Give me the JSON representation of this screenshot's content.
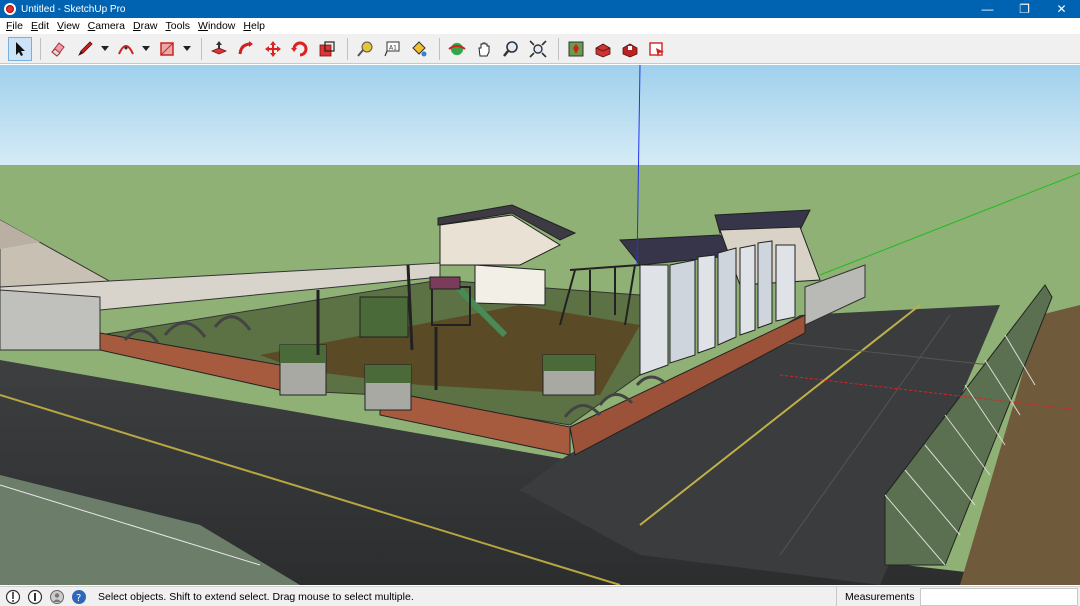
{
  "window": {
    "title": "Untitled - SketchUp Pro",
    "minimize_glyph": "—",
    "restore_glyph": "❐",
    "close_glyph": "✕"
  },
  "menu": [
    {
      "label": "File",
      "key": "F",
      "rest": "ile"
    },
    {
      "label": "Edit",
      "key": "E",
      "rest": "dit"
    },
    {
      "label": "View",
      "key": "V",
      "rest": "iew"
    },
    {
      "label": "Camera",
      "key": "C",
      "rest": "amera"
    },
    {
      "label": "Draw",
      "key": "D",
      "rest": "raw"
    },
    {
      "label": "Tools",
      "key": "T",
      "rest": "ools"
    },
    {
      "label": "Window",
      "key": "W",
      "rest": "indow"
    },
    {
      "label": "Help",
      "key": "H",
      "rest": "elp"
    }
  ],
  "toolbar": {
    "tools": [
      "select-icon",
      "eraser-icon",
      "pencil-line-icon",
      "arc-icon",
      "rectangle-icon",
      "push-pull-icon",
      "follow-me-icon",
      "move-icon",
      "rotate-icon",
      "scale-icon",
      "tape-measure-icon",
      "text-icon",
      "paint-bucket-icon",
      "orbit-icon",
      "pan-icon",
      "zoom-icon",
      "zoom-extents-icon",
      "add-location-icon",
      "3d-warehouse-icon",
      "extension-warehouse-icon",
      "layout-send-icon"
    ],
    "active_tool": "select-icon"
  },
  "viewport": {
    "sky_color": "#bfe0f3",
    "ground_color": "#8fb175",
    "axes": {
      "blue": "#2233ee",
      "green": "#22bb22",
      "red": "#dd2222"
    }
  },
  "statusbar": {
    "icons": [
      "geo-location-icon",
      "credits-icon",
      "user-icon",
      "help-icon"
    ],
    "message": "Select objects. Shift to extend select. Drag mouse to select multiple.",
    "measurements_label": "Measurements",
    "measurements_value": ""
  }
}
